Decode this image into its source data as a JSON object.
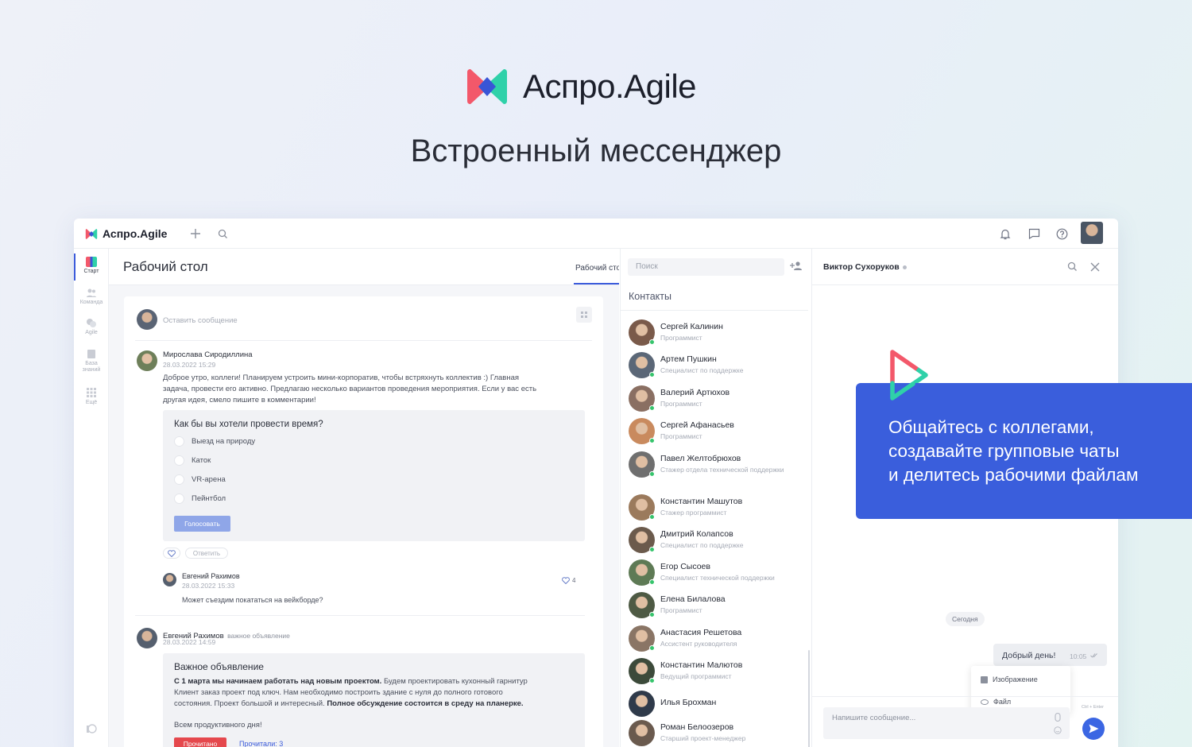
{
  "hero": {
    "brand": "Аспро.Agile",
    "title": "Встроенный мессенджер"
  },
  "colors": {
    "accent": "#3a5edc",
    "online": "#36c46c",
    "logo_red": "#f3586a",
    "logo_teal": "#2fd1a9",
    "logo_blue": "#3955d6"
  },
  "app": {
    "brand": "Аспро.Agile",
    "topbar_icons": [
      "plus-icon",
      "search-icon",
      "bell-icon",
      "chat-icon",
      "help-icon",
      "avatar"
    ],
    "nav": [
      {
        "label": "Старт",
        "icon": "start-icon"
      },
      {
        "label": "Команда",
        "icon": "team-icon"
      },
      {
        "label": "Agile",
        "icon": "agile-icon"
      },
      {
        "label": "База знаний",
        "icon": "knowledge-base-icon"
      },
      {
        "label": "Ещё",
        "icon": "grid-icon"
      }
    ],
    "desk": {
      "title": "Рабочий стол",
      "tab": "Рабочий стол"
    },
    "feed": {
      "compose_placeholder": "Оставить сообщение",
      "post1": {
        "author": "Мирослава Сиродиллина",
        "date": "28.03.2022 15:29",
        "text_1": "Доброе утро, коллеги! Планируем устроить мини-корпоратив, чтобы встряхнуть коллектив :) Главная",
        "text_2": "задача, провести его активно. Предлагаю несколько вариантов проведения мероприятия. Если у вас есть",
        "text_3": "другая идея, смело пишите в комментарии!",
        "poll_question": "Как бы вы хотели провести время?",
        "poll_options": [
          "Выезд на природу",
          "Каток",
          "VR-арена",
          "Пейнтбол"
        ],
        "vote_label": "Голосовать",
        "reply_label": "Ответить"
      },
      "comment": {
        "author": "Евгений Рахимов",
        "date": "28.03.2022 15:33",
        "text": "Может съездим покататься на вейкборде?",
        "likes": "4"
      },
      "post2": {
        "author": "Евгений Рахимов",
        "tag": "важное объявление",
        "date": "28.03.2022 14:59",
        "title": "Важное объявление",
        "bold_1": "С 1 марта мы начинаем работать над новым проектом.",
        "text_1": " Будем проектировать кухонный гарнитур",
        "text_2": "Клиент заказ проект под ключ. Нам необходимо построить здание с нуля до полного готового",
        "text_3": "состояния. Проект большой и интересный. ",
        "bold_2": "Полное обсуждение состоится в среду на планерке.",
        "text_4": "Всем продуктивного дня!",
        "read_label": "Прочитано",
        "read_count": "Прочитали: 3"
      }
    },
    "contacts": {
      "search_placeholder": "Поиск",
      "heading": "Контакты",
      "list": [
        {
          "name": "Сергей Калинин",
          "role": "Программист",
          "color": "#7a5a4a"
        },
        {
          "name": "Артем Пушкин",
          "role": "Специалист по поддержке",
          "color": "#5b6777"
        },
        {
          "name": "Валерий Артюхов",
          "role": "Программист",
          "color": "#8a6f62"
        },
        {
          "name": "Сергей Афанасьев",
          "role": "Программист",
          "color": "#c98a5e"
        },
        {
          "name": "Павел Желтобрюхов",
          "role": "Стажер отдела технической поддержки",
          "color": "#6f6f6f"
        },
        {
          "name": "Константин Машутов",
          "role": "Стажер программист",
          "color": "#9b7a5c"
        },
        {
          "name": "Дмитрий Колапсов",
          "role": "Специалист по поддержке",
          "color": "#6b5a4c"
        },
        {
          "name": "Егор Сысоев",
          "role": "Специалист технической поддержки",
          "color": "#5e7a55"
        },
        {
          "name": "Елена Билалова",
          "role": "Программист",
          "color": "#4e5a44"
        },
        {
          "name": "Анастасия Решетова",
          "role": "Ассистент руководителя",
          "color": "#8a7565"
        },
        {
          "name": "Константин Малютов",
          "role": "Ведущий программист",
          "color": "#3c4a3a"
        },
        {
          "name": "Илья Брохман",
          "role": "",
          "color": "#2f3a4a"
        },
        {
          "name": "Роман Белоозеров",
          "role": "Старший проект-менеджер",
          "color": "#6a5a4e"
        }
      ]
    },
    "chat": {
      "contact_name": "Виктор Сухоруков",
      "today_label": "Сегодня",
      "message": "Добрый день!",
      "message_time": "10:05",
      "attach_image": "Изображение",
      "attach_file": "Файл",
      "composer_placeholder": "Напишите сообщение...",
      "send_hint": "Ctrl + Enter"
    }
  },
  "promo": {
    "line1": "Общайтесь с коллегами,",
    "line2": "создавайте групповые чаты",
    "line3": "и делитесь рабочими файлам"
  }
}
